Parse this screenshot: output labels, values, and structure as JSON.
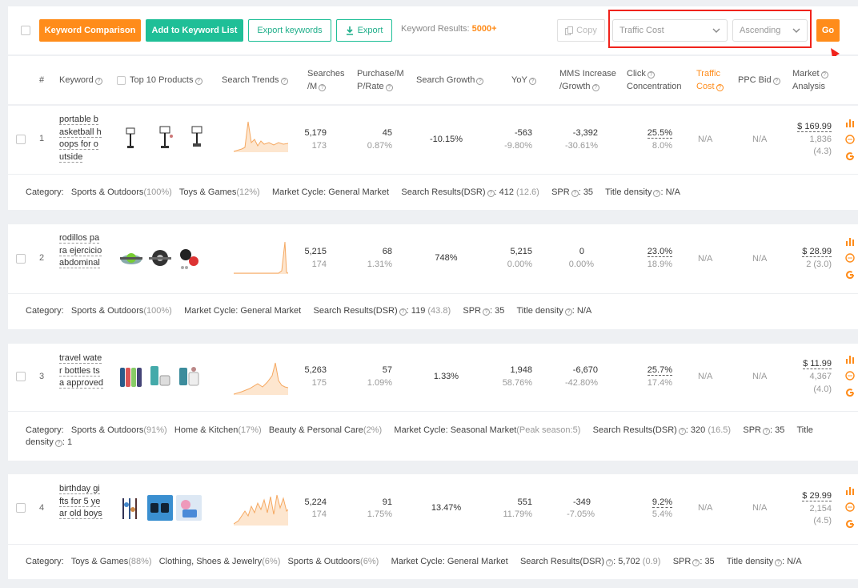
{
  "toolbar": {
    "keyword_comparison": "Keyword Comparison",
    "add_to_list": "Add to Keyword List",
    "export_keywords": "Export keywords",
    "export": "Export",
    "results_label": "Keyword Results:",
    "results_count": "5000+",
    "copy": "Copy",
    "sort_field": "Traffic Cost",
    "sort_order": "Ascending",
    "go": "Go"
  },
  "header": {
    "index": "#",
    "keyword": "Keyword",
    "top10": "Top 10 Products",
    "trends": "Search Trends",
    "searches_1": "Searches",
    "searches_2": "/M",
    "purchase_1": "Purchase/M",
    "purchase_2": "P/Rate",
    "growth": "Search Growth",
    "yoy": "YoY",
    "mms_1": "MMS Increase",
    "mms_2": "/Growth",
    "click_1": "Click",
    "click_2": "Concentration",
    "traffic_1": "Traffic",
    "traffic_2": "Cost",
    "ppc": "PPC Bid",
    "market_1": "Market",
    "market_2": "Analysis"
  },
  "rows": [
    {
      "index": "1",
      "keyword": [
        "portable b",
        "asketball h",
        "oops for o",
        "utside"
      ],
      "searches": "5,179",
      "searches_sub": "173",
      "purchase": "45",
      "purchase_rate": "0.87%",
      "growth": "-10.15%",
      "yoy": "-563",
      "yoy_pct": "-9.80%",
      "mms": "-3,392",
      "mms_pct": "-30.61%",
      "click": "25.5%",
      "click_sub": "8.0%",
      "traffic": "N/A",
      "ppc": "N/A",
      "price": "$ 169.99",
      "market_sub1": "1,836",
      "market_sub2": "(4.3)",
      "meta": {
        "category_label": "Category:",
        "cats": [
          {
            "name": "Sports & Outdoors",
            "pct": "(100%)"
          },
          {
            "name": "Toys & Games",
            "pct": "(12%)"
          }
        ],
        "cycle": "Market Cycle: General Market",
        "cycle_extra": "",
        "dsr_label": "Search Results(DSR)",
        "dsr_val": ": 412",
        "dsr_sub": "(12.6)",
        "spr_label": "SPR",
        "spr_val": ": 35",
        "title_label": "Title density",
        "title_val": ": N/A"
      }
    },
    {
      "index": "2",
      "keyword": [
        "rodillos pa",
        "ra ejercicio",
        "abdominal"
      ],
      "searches": "5,215",
      "searches_sub": "174",
      "purchase": "68",
      "purchase_rate": "1.31%",
      "growth": "748%",
      "yoy": "5,215",
      "yoy_pct": "0.00%",
      "mms": "0",
      "mms_pct": "0.00%",
      "click": "23.0%",
      "click_sub": "18.9%",
      "traffic": "N/A",
      "ppc": "N/A",
      "price": "$ 28.99",
      "market_sub1": "2 (3.0)",
      "market_sub2": "",
      "meta": {
        "category_label": "Category:",
        "cats": [
          {
            "name": "Sports & Outdoors",
            "pct": "(100%)"
          }
        ],
        "cycle": "Market Cycle: General Market",
        "cycle_extra": "",
        "dsr_label": "Search Results(DSR)",
        "dsr_val": ": 119",
        "dsr_sub": "(43.8)",
        "spr_label": "SPR",
        "spr_val": ": 35",
        "title_label": "Title density",
        "title_val": ": N/A"
      }
    },
    {
      "index": "3",
      "keyword": [
        "travel wate",
        "r bottles ts",
        "a approved"
      ],
      "searches": "5,263",
      "searches_sub": "175",
      "purchase": "57",
      "purchase_rate": "1.09%",
      "growth": "1.33%",
      "yoy": "1,948",
      "yoy_pct": "58.76%",
      "mms": "-6,670",
      "mms_pct": "-42.80%",
      "click": "25.7%",
      "click_sub": "17.4%",
      "traffic": "N/A",
      "ppc": "N/A",
      "price": "$ 11.99",
      "market_sub1": "4,367",
      "market_sub2": "(4.0)",
      "meta": {
        "category_label": "Category:",
        "cats": [
          {
            "name": "Sports & Outdoors",
            "pct": "(91%)"
          },
          {
            "name": "Home & Kitchen",
            "pct": "(17%)"
          },
          {
            "name": "Beauty & Personal Care",
            "pct": "(2%)"
          }
        ],
        "cycle": "Market Cycle: Seasonal Market",
        "cycle_extra": "(Peak season:5)",
        "dsr_label": "Search Results(DSR)",
        "dsr_val": ": 320",
        "dsr_sub": "(16.5)",
        "spr_label": "SPR",
        "spr_val": ": 35",
        "title_label": "Title density",
        "title_val": ": 1"
      }
    },
    {
      "index": "4",
      "keyword": [
        "birthday gi",
        "fts for 5 ye",
        "ar old boys"
      ],
      "searches": "5,224",
      "searches_sub": "174",
      "purchase": "91",
      "purchase_rate": "1.75%",
      "growth": "13.47%",
      "yoy": "551",
      "yoy_pct": "11.79%",
      "mms": "-349",
      "mms_pct": "-7.05%",
      "click": "9.2%",
      "click_sub": "5.4%",
      "traffic": "N/A",
      "ppc": "N/A",
      "price": "$ 29.99",
      "market_sub1": "2,154",
      "market_sub2": "(4.5)",
      "meta": {
        "category_label": "Category:",
        "cats": [
          {
            "name": "Toys & Games",
            "pct": "(88%)"
          },
          {
            "name": "Clothing, Shoes & Jewelry",
            "pct": "(6%)"
          },
          {
            "name": "Sports & Outdoors",
            "pct": "(6%)"
          }
        ],
        "cycle": "Market Cycle: General Market",
        "cycle_extra": "",
        "dsr_label": "Search Results(DSR)",
        "dsr_val": ": 5,702",
        "dsr_sub": "(0.9)",
        "spr_label": "SPR",
        "spr_val": ": 35",
        "title_label": "Title density",
        "title_val": ": N/A"
      }
    }
  ],
  "colors": {
    "orange": "#ff8c1a",
    "teal": "#1fbf97",
    "red": "#f0231c",
    "trend": "#f5a861"
  }
}
